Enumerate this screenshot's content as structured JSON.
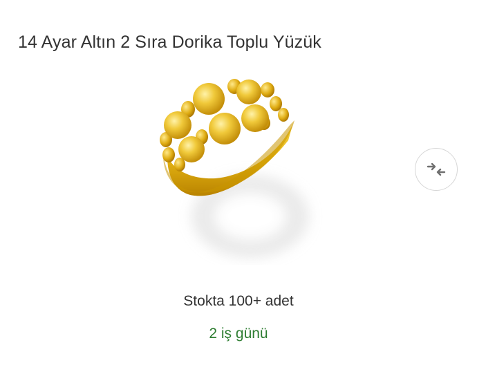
{
  "product": {
    "title": "14 Ayar Altın 2 Sıra Dorika Toplu Yüzük",
    "stock_text": "Stokta 100+ adet",
    "delivery_text": "2 iş günü",
    "image_icon": "gold-ring-image"
  },
  "compare": {
    "icon": "compare-arrows-icon"
  },
  "colors": {
    "delivery": "#2e7d32",
    "text": "#333333",
    "gold": "#e3b81e"
  }
}
